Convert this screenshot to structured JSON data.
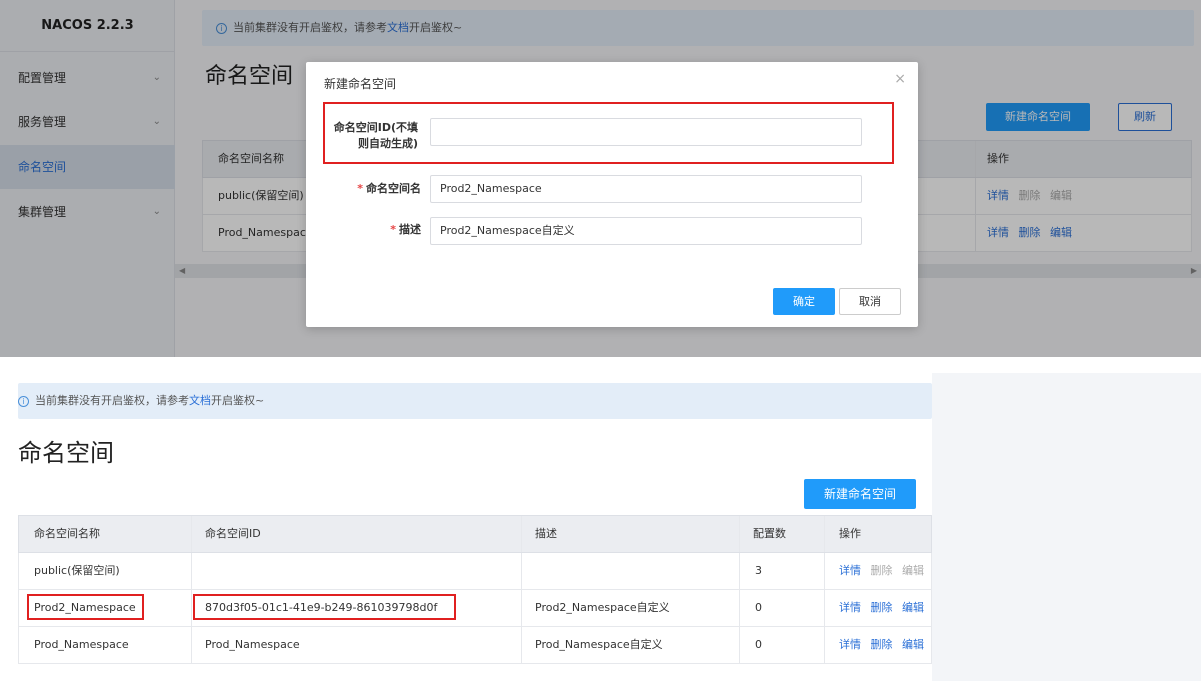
{
  "top": {
    "brand": "NACOS 2.2.3",
    "menu": [
      {
        "label": "配置管理",
        "expandable": true
      },
      {
        "label": "服务管理",
        "expandable": true
      },
      {
        "label": "命名空间",
        "active": true
      },
      {
        "label": "集群管理",
        "expandable": true
      }
    ],
    "alert": {
      "prefix": "当前集群没有开启鉴权，请参考",
      "link": "文档",
      "suffix": "开启鉴权~"
    },
    "page_title": "命名空间",
    "new_button": "新建命名空间",
    "refresh_button": "刷新",
    "table": {
      "header_name": "命名空间名称",
      "header_ops": "操作",
      "rows": [
        {
          "name": "public(保留空间)",
          "ops": [
            "详情",
            "删除",
            "编辑"
          ]
        },
        {
          "name": "Prod_Namespace",
          "ops": [
            "详情",
            "删除",
            "编辑"
          ]
        }
      ]
    },
    "dialog": {
      "title": "新建命名空间",
      "close": "×",
      "id_label_line1": "命名空间ID(不填",
      "id_label_line2": "则自动生成)",
      "id_value": "",
      "name_label": "命名空间名",
      "name_value": "Prod2_Namespace",
      "desc_label": "描述",
      "desc_value": "Prod2_Namespace自定义",
      "required_mark": "*",
      "confirm": "确定",
      "cancel": "取消"
    }
  },
  "bottom": {
    "alert": {
      "prefix": "当前集群没有开启鉴权，请参考",
      "link": "文档",
      "suffix": "开启鉴权~"
    },
    "page_title": "命名空间",
    "new_button": "新建命名空间",
    "table": {
      "headers": [
        "命名空间名称",
        "命名空间ID",
        "描述",
        "配置数",
        "操作"
      ],
      "rows": [
        {
          "name": "public(保留空间)",
          "id": "",
          "desc": "",
          "count": "3",
          "ops": [
            "详情",
            "删除",
            "编辑"
          ]
        },
        {
          "name": "Prod2_Namespace",
          "id": "870d3f05-01c1-41e9-b249-861039798d0f",
          "desc": "Prod2_Namespace自定义",
          "count": "0",
          "ops": [
            "详情",
            "删除",
            "编辑"
          ]
        },
        {
          "name": "Prod_Namespace",
          "id": "Prod_Namespace",
          "desc": "Prod_Namespace自定义",
          "count": "0",
          "ops": [
            "详情",
            "删除",
            "编辑"
          ]
        }
      ]
    }
  },
  "colors": {
    "primary": "#209bfa",
    "link": "#2a6fd6",
    "highlight": "#e02020",
    "required": "#e64545"
  }
}
